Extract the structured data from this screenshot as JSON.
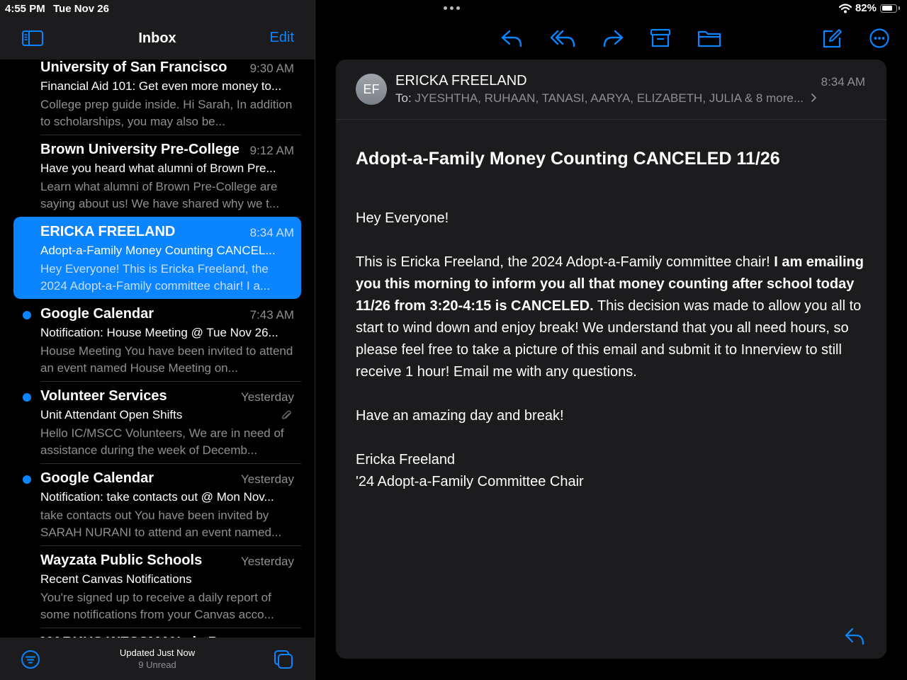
{
  "status_bar": {
    "time": "4:55 PM",
    "date": "Tue Nov 26",
    "battery_text": "82%",
    "battery_level": 0.82
  },
  "sidebar": {
    "title": "Inbox",
    "edit_label": "Edit",
    "footer_status": "Updated Just Now",
    "footer_unread": "9 Unread"
  },
  "mails": [
    {
      "sender": "University of San Francisco",
      "time": "9:30 AM",
      "subject": "Financial Aid 101: Get even more money to...",
      "preview": "College prep guide inside. Hi Sarah, In addition to scholarships, you may also be...",
      "unread": false
    },
    {
      "sender": "Brown University Pre-College",
      "time": "9:12 AM",
      "subject": "Have you heard what alumni of Brown Pre...",
      "preview": "Learn what alumni of Brown Pre-College are saying about us! We have shared why we t...",
      "unread": false
    },
    {
      "sender": "ERICKA FREELAND",
      "time": "8:34 AM",
      "subject": "Adopt-a-Family Money Counting CANCEL...",
      "preview": "Hey Everyone! This is Ericka Freeland, the 2024 Adopt-a-Family committee chair! I a...",
      "unread": false,
      "selected": true
    },
    {
      "sender": "Google Calendar",
      "time": "7:43 AM",
      "subject": "Notification: House Meeting @ Tue Nov 26...",
      "preview": "House Meeting You have been invited to attend an event named House Meeting on...",
      "unread": true
    },
    {
      "sender": "Volunteer Services",
      "time": "Yesterday",
      "subject": "Unit Attendant Open Shifts",
      "preview": "Hello IC/MSCC Volunteers, We are in need of assistance during the week of Decemb...",
      "unread": true,
      "attachment": true
    },
    {
      "sender": "Google Calendar",
      "time": "Yesterday",
      "subject": "Notification: take contacts out @ Mon Nov...",
      "preview": "take contacts out You have been invited by SARAH NURANI to attend an event named...",
      "unread": true
    },
    {
      "sender": "Wayzata Public Schools",
      "time": "Yesterday",
      "subject": "Recent Canvas Notifications",
      "preview": "You're signed up to receive a daily report of some notifications from your Canvas acco...",
      "unread": false
    },
    {
      "sender": "MARKUS WESSMAN via P...",
      "time": "Yesterday",
      "subject": "",
      "preview": "",
      "unread": false
    }
  ],
  "message": {
    "avatar_initials": "EF",
    "from": "ERICKA FREELAND",
    "time": "8:34 AM",
    "to_label": "To:",
    "to": "JYESHTHA, RUHAAN, TANASI, AARYA, ELIZABETH, JULIA & 8 more...",
    "subject": "Adopt-a-Family Money Counting CANCELED 11/26",
    "greeting": "Hey Everyone!",
    "para_intro": "This is Ericka Freeland, the 2024 Adopt-a-Family committee chair! ",
    "para_bold": "I am emailing you this morning to inform you all that money counting after school today 11/26 from 3:20-4:15 is CANCELED.",
    "para_rest": " This decision was made to allow you all to start to wind down and enjoy break! We understand that you all need hours, so please feel free to take a picture of this email and submit it to Innerview to still receive 1 hour! Email me with any questions.",
    "closing": "Have an amazing day and break!",
    "signature_name": "Ericka Freeland",
    "signature_title": "'24 Adopt-a-Family Committee Chair"
  },
  "colors": {
    "accent": "#0a84ff",
    "background": "#000000",
    "panel": "#1c1c1e",
    "secondary_text": "#8e8e93"
  },
  "icons": {
    "sidebar_toggle": "sidebar-icon",
    "reply": "reply-icon",
    "reply_all": "reply-all-icon",
    "forward": "forward-icon",
    "archive": "archive-icon",
    "move": "folder-icon",
    "compose": "compose-icon",
    "more": "ellipsis-circle-icon",
    "filter": "filter-icon",
    "multiwindow": "multiwindow-icon",
    "attachment": "paperclip-icon",
    "wifi": "wifi-icon",
    "battery": "battery-icon"
  }
}
